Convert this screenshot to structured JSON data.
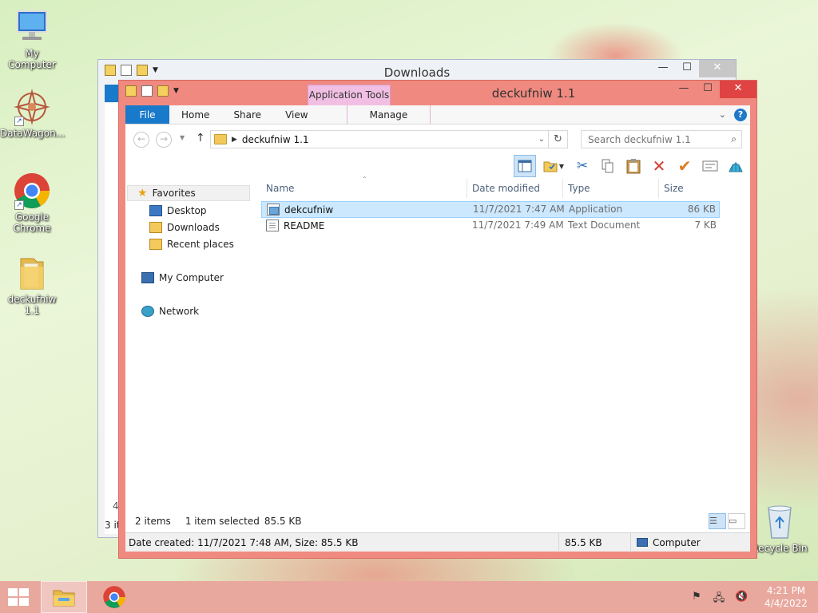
{
  "desktop": {
    "icons": [
      {
        "label": "My Computer"
      },
      {
        "label": "DataWagon..."
      },
      {
        "label": "Google Chrome"
      },
      {
        "label": "deckufniw 1.1"
      },
      {
        "label": "Recycle Bin"
      }
    ]
  },
  "back_window": {
    "title": "Downloads",
    "status": "3 it",
    "partial_number": "4"
  },
  "window": {
    "title": "deckufniw 1.1",
    "contextual_tab": "Application Tools",
    "tabs": {
      "file": "File",
      "home": "Home",
      "share": "Share",
      "view": "View",
      "manage": "Manage"
    },
    "address": "deckufniw 1.1",
    "search_placeholder": "Search deckufniw 1.1",
    "nav": {
      "favorites": "Favorites",
      "desktop": "Desktop",
      "downloads": "Downloads",
      "recent": "Recent places",
      "my_computer": "My Computer",
      "network": "Network"
    },
    "columns": {
      "name": "Name",
      "date": "Date modified",
      "type": "Type",
      "size": "Size"
    },
    "files": [
      {
        "name": "dekcufniw",
        "date": "11/7/2021 7:47 AM",
        "type": "Application",
        "size": "86 KB",
        "selected": true
      },
      {
        "name": "README",
        "date": "11/7/2021 7:49 AM",
        "type": "Text Document",
        "size": "7 KB",
        "selected": false
      }
    ],
    "status": {
      "items": "2 items",
      "selected": "1 item selected",
      "selected_size": "85.5 KB"
    },
    "details": {
      "info": "Date created: 11/7/2021 7:48 AM, Size: 85.5 KB",
      "size": "85.5 KB",
      "location": "Computer"
    }
  },
  "taskbar": {
    "time": "4:21 PM",
    "date": "4/4/2022"
  },
  "colors": {
    "accent": "#1979ca",
    "window_frame": "#f08a80",
    "close_button": "#e04343",
    "contextual_tab": "#f1bfe3",
    "taskbar": "#e9a89e"
  }
}
